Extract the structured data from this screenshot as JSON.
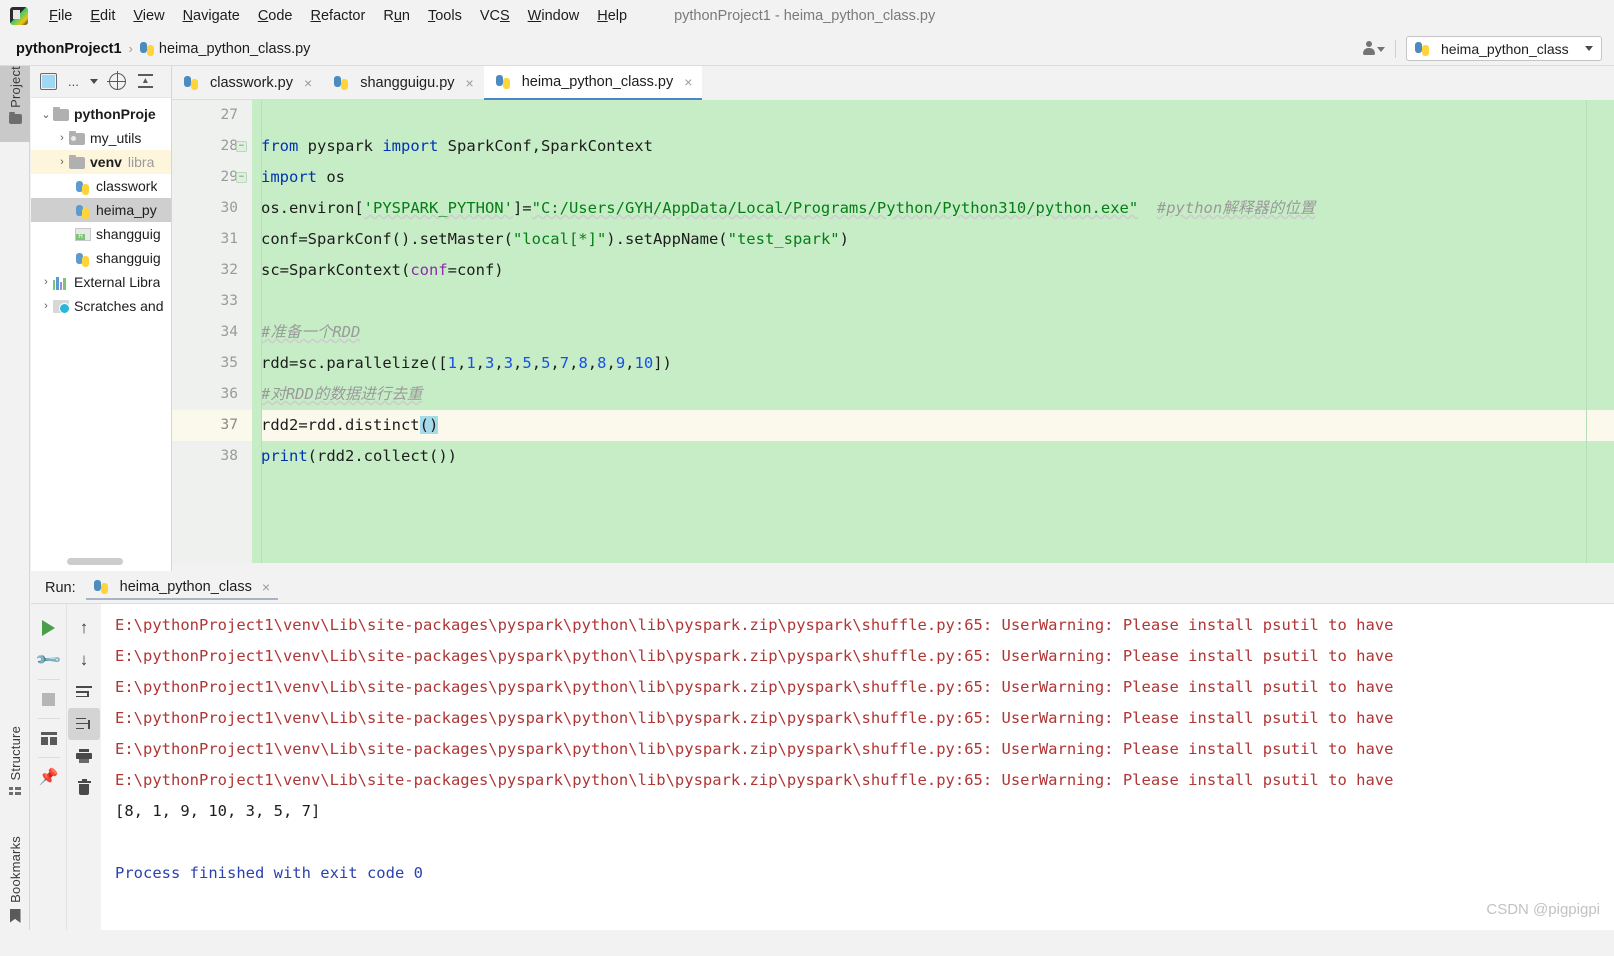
{
  "app": {
    "window_title": "pythonProject1 - heima_python_class.py",
    "logo_name": "pycharm-logo"
  },
  "menu": {
    "items": [
      {
        "label": "File",
        "mnemonic": "F"
      },
      {
        "label": "Edit",
        "mnemonic": "E"
      },
      {
        "label": "View",
        "mnemonic": "V"
      },
      {
        "label": "Navigate",
        "mnemonic": "N"
      },
      {
        "label": "Code",
        "mnemonic": "C"
      },
      {
        "label": "Refactor",
        "mnemonic": "R"
      },
      {
        "label": "Run",
        "mnemonic": "u"
      },
      {
        "label": "Tools",
        "mnemonic": "T"
      },
      {
        "label": "VCS",
        "mnemonic": "S"
      },
      {
        "label": "Window",
        "mnemonic": "W"
      },
      {
        "label": "Help",
        "mnemonic": "H"
      }
    ]
  },
  "navbar": {
    "breadcrumb_root": "pythonProject1",
    "breadcrumb_separator": "›",
    "breadcrumb_file": "heima_python_class.py",
    "run_config": "heima_python_class",
    "person_icon": "person-dropdown-icon"
  },
  "toolstrip": {
    "buttons": [
      {
        "label": "Project",
        "icon": "folder-icon",
        "active": true
      },
      {
        "label": "Structure",
        "icon": "structure-icon",
        "active": false
      },
      {
        "label": "Bookmarks",
        "icon": "bookmark-icon",
        "active": false
      }
    ]
  },
  "project_pane": {
    "toolbar": {
      "select_opened_file": "select-opened-file-icon",
      "ellipsis": "...",
      "locate": "locate-icon",
      "collapse_all": "collapse-all-icon"
    },
    "tree": [
      {
        "label": "pythonProje",
        "sub": "",
        "icon": "folder-icon",
        "arrow": "⌄",
        "depth": 0,
        "bold": true,
        "state": "none"
      },
      {
        "label": "my_utils",
        "sub": "",
        "icon": "source-folder-icon",
        "arrow": "›",
        "depth": 1,
        "bold": false,
        "state": "none"
      },
      {
        "label": "venv",
        "sub": "libra",
        "icon": "folder-icon",
        "arrow": "›",
        "depth": 1,
        "bold": true,
        "state": "highlight"
      },
      {
        "label": "classwork",
        "sub": "",
        "icon": "python-file-icon",
        "arrow": "",
        "depth": 2,
        "bold": false,
        "state": "none"
      },
      {
        "label": "heima_py",
        "sub": "",
        "icon": "python-file-icon",
        "arrow": "",
        "depth": 2,
        "bold": false,
        "state": "selected"
      },
      {
        "label": "shangguig",
        "sub": "",
        "icon": "html-file-icon",
        "arrow": "",
        "depth": 2,
        "bold": false,
        "state": "none"
      },
      {
        "label": "shangguig",
        "sub": "",
        "icon": "python-file-icon",
        "arrow": "",
        "depth": 2,
        "bold": false,
        "state": "none"
      },
      {
        "label": "External Libra",
        "sub": "",
        "icon": "library-icon",
        "arrow": "›",
        "depth": 0,
        "bold": false,
        "state": "none"
      },
      {
        "label": "Scratches and",
        "sub": "",
        "icon": "scratches-icon",
        "arrow": "›",
        "depth": 0,
        "bold": false,
        "state": "none"
      }
    ]
  },
  "editor": {
    "tabs": [
      {
        "label": "classwork.py",
        "icon": "python-file-icon",
        "active": false,
        "close": "×"
      },
      {
        "label": "shangguigu.py",
        "icon": "python-file-icon",
        "active": false,
        "close": "×"
      },
      {
        "label": "heima_python_class.py",
        "icon": "python-file-icon",
        "active": true,
        "close": "×"
      }
    ],
    "first_line_number": 27,
    "current_line": 37,
    "lines": [
      {
        "num": 27,
        "text": ""
      },
      {
        "num": 28,
        "text": "from pyspark import SparkConf,SparkContext",
        "fold": "−"
      },
      {
        "num": 29,
        "text": "import os",
        "fold": "−"
      },
      {
        "num": 30,
        "text": "os.environ['PYSPARK_PYTHON']=\"C:/Users/GYH/AppData/Local/Programs/Python/Python310/python.exe\"  #python解释器的位置"
      },
      {
        "num": 31,
        "text": "conf=SparkConf().setMaster(\"local[*]\").setAppName(\"test_spark\")"
      },
      {
        "num": 32,
        "text": "sc=SparkContext(conf=conf)"
      },
      {
        "num": 33,
        "text": ""
      },
      {
        "num": 34,
        "text": "#准备一个RDD"
      },
      {
        "num": 35,
        "text": "rdd=sc.parallelize([1,1,3,3,5,5,7,8,8,9,10])"
      },
      {
        "num": 36,
        "text": "#对RDD的数据进行去重"
      },
      {
        "num": 37,
        "text": "rdd2=rdd.distinct()"
      },
      {
        "num": 38,
        "text": "print(rdd2.collect())"
      }
    ]
  },
  "run_panel": {
    "label": "Run:",
    "tab": "heima_python_class",
    "tab_close": "×",
    "tab_icon": "python-file-icon",
    "left_buttons": [
      {
        "name": "rerun-button",
        "icon": "play-icon"
      },
      {
        "name": "settings-button",
        "icon": "wrench-icon"
      },
      {
        "name": "stop-button",
        "icon": "stop-icon"
      },
      {
        "name": "layout-button",
        "icon": "layout-icon"
      },
      {
        "name": "pin-tab-button",
        "icon": "pin-icon"
      }
    ],
    "right_buttons": [
      {
        "name": "up-button",
        "icon": "arrow-up-icon"
      },
      {
        "name": "down-button",
        "icon": "arrow-down-icon"
      },
      {
        "name": "soft-wrap-button",
        "icon": "soft-wrap-icon"
      },
      {
        "name": "scroll-to-end-button",
        "icon": "scroll-to-end-icon",
        "active": true
      },
      {
        "name": "print-button",
        "icon": "printer-icon"
      },
      {
        "name": "clear-all-button",
        "icon": "trash-icon"
      }
    ],
    "console_lines": [
      {
        "kind": "warn",
        "text": "E:\\pythonProject1\\venv\\Lib\\site-packages\\pyspark\\python\\lib\\pyspark.zip\\pyspark\\shuffle.py:65: UserWarning: Please install psutil to have"
      },
      {
        "kind": "warn",
        "text": "E:\\pythonProject1\\venv\\Lib\\site-packages\\pyspark\\python\\lib\\pyspark.zip\\pyspark\\shuffle.py:65: UserWarning: Please install psutil to have"
      },
      {
        "kind": "warn",
        "text": "E:\\pythonProject1\\venv\\Lib\\site-packages\\pyspark\\python\\lib\\pyspark.zip\\pyspark\\shuffle.py:65: UserWarning: Please install psutil to have"
      },
      {
        "kind": "warn",
        "text": "E:\\pythonProject1\\venv\\Lib\\site-packages\\pyspark\\python\\lib\\pyspark.zip\\pyspark\\shuffle.py:65: UserWarning: Please install psutil to have"
      },
      {
        "kind": "warn",
        "text": "E:\\pythonProject1\\venv\\Lib\\site-packages\\pyspark\\python\\lib\\pyspark.zip\\pyspark\\shuffle.py:65: UserWarning: Please install psutil to have"
      },
      {
        "kind": "warn",
        "text": "E:\\pythonProject1\\venv\\Lib\\site-packages\\pyspark\\python\\lib\\pyspark.zip\\pyspark\\shuffle.py:65: UserWarning: Please install psutil to have"
      },
      {
        "kind": "out",
        "text": "[8, 1, 9, 10, 3, 5, 7]"
      },
      {
        "kind": "blank",
        "text": ""
      },
      {
        "kind": "fin",
        "text": "Process finished with exit code 0"
      }
    ]
  },
  "watermark": "CSDN @pigpigpi",
  "colors": {
    "editor_background": "#c7edc7",
    "current_line": "#fbf8ec",
    "gutter": "#eff1ef",
    "keyword": "#0033b3",
    "string": "#067d17",
    "number": "#1750eb",
    "comment": "#9a9a9a",
    "named_arg": "#8c2ea8",
    "console_warning": "#b03535",
    "console_finished": "#2a42b0",
    "tab_underline": "#4a86c8",
    "selection": "#a5dbe8"
  }
}
